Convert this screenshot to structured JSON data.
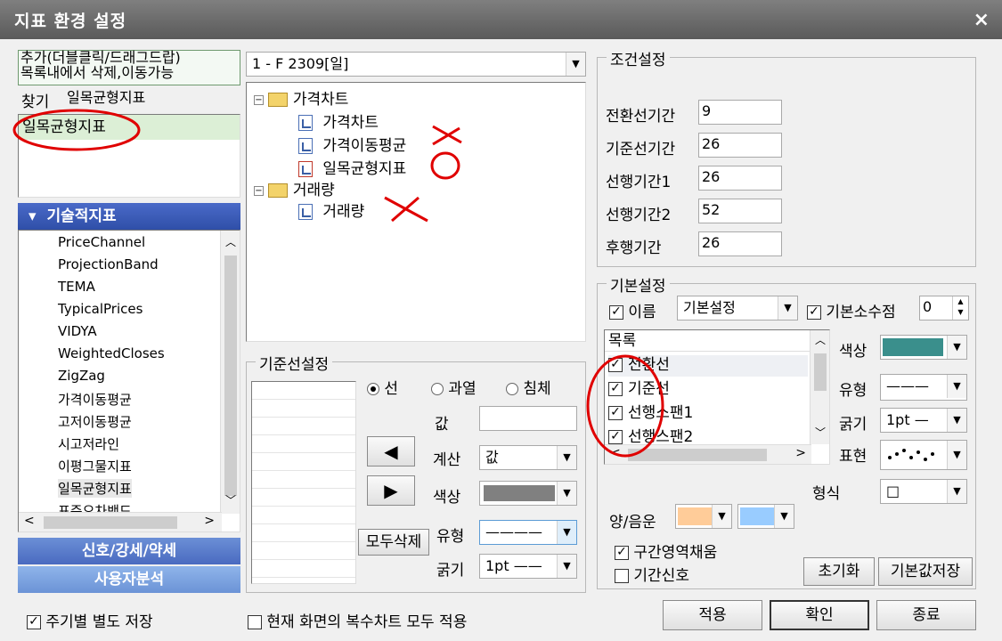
{
  "window": {
    "title": "지표 환경 설정",
    "close": "×"
  },
  "left": {
    "help_line1": "추가(더블클릭/드래그드랍)",
    "help_line2": "목록내에서 삭제,이동가능",
    "find_label": "찾기",
    "find_value": "일목균형지표",
    "result_item": "일목균형지표",
    "section_title": "기술적지표",
    "list_items": [
      "PriceChannel",
      "ProjectionBand",
      "TEMA",
      "TypicalPrices",
      "VIDYA",
      "WeightedCloses",
      "ZigZag",
      "가격이동평균",
      "고저이동평균",
      "시고저라인",
      "이평그물지표",
      "일목균형지표",
      "표준오차밴드"
    ],
    "section2": "신호/강세/약세",
    "section3": "사용자분석"
  },
  "middle": {
    "chart_select": "1 - F 2309[일]",
    "tree": {
      "folder1": "가격차트",
      "items1": [
        "가격차트",
        "가격이동평균",
        "일목균형지표"
      ],
      "folder2": "거래량",
      "items2": [
        "거래량"
      ]
    },
    "baseline": {
      "legend": "기준선설정",
      "radio_line": "선",
      "radio_overheat": "과열",
      "radio_dip": "침체",
      "value_label": "값",
      "value": "",
      "calc_label": "계산",
      "calc_value": "값",
      "color_label": "색상",
      "type_label": "유형",
      "type_value": "————",
      "width_label": "굵기",
      "width_value": "1pt ——",
      "delete_all": "모두삭제",
      "left_arrow": "◀",
      "right_arrow": "▶"
    }
  },
  "conditions": {
    "legend": "조건설정",
    "fields": [
      {
        "label": "전환선기간",
        "value": "9"
      },
      {
        "label": "기준선기간",
        "value": "26"
      },
      {
        "label": "선행기간1",
        "value": "26"
      },
      {
        "label": "선행기간2",
        "value": "52"
      },
      {
        "label": "후행기간",
        "value": "26"
      }
    ]
  },
  "basic": {
    "legend": "기본설정",
    "name_label": "이름",
    "name_value": "기본설정",
    "decimal_label": "기본소수점",
    "decimal_value": "0",
    "list_header": "목록",
    "list_items": [
      "전환선",
      "기준선",
      "선행스팬1",
      "선행스팬2"
    ],
    "color_label": "색상",
    "color_value": "#3a8f8c",
    "type_label": "유형",
    "type_value": "———",
    "width_label": "굵기",
    "width_value": "1pt —",
    "display_label": "표현",
    "format_label": "형식",
    "format_value": "□",
    "posneg_label": "양/음운",
    "pos_color": "#ffcc99",
    "neg_color": "#99ccff",
    "fill_label": "구간영역채움",
    "signal_label": "기간신호",
    "reset": "초기화",
    "save_default": "기본값저장"
  },
  "footer": {
    "period_save": "주기별 별도 저장",
    "apply_all": "현재 화면의 복수차트 모두 적용",
    "apply": "적용",
    "ok": "확인",
    "close": "종료"
  },
  "annotations": {
    "x_mark": "✕",
    "o_mark": "◯"
  }
}
